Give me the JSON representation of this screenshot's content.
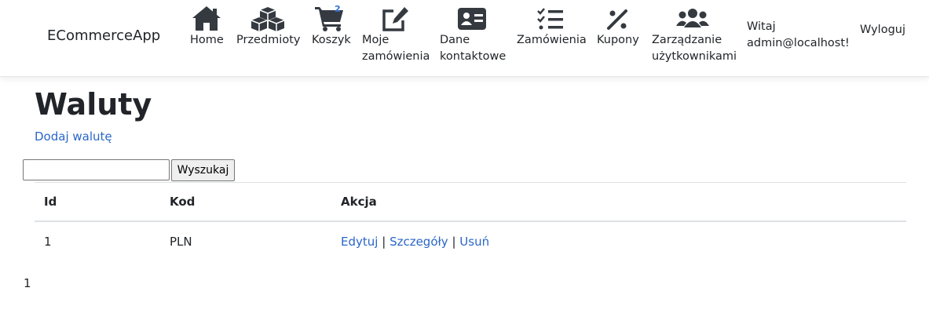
{
  "navbar": {
    "brand": "ECommerceApp",
    "items": [
      {
        "id": "home",
        "label_lines": [
          "Home"
        ],
        "icon": "home-icon"
      },
      {
        "id": "items",
        "label_lines": [
          "Przedmioty"
        ],
        "icon": "cubes-icon"
      },
      {
        "id": "cart",
        "label_lines": [
          "Koszyk"
        ],
        "icon": "cart-icon",
        "badge": "2"
      },
      {
        "id": "my-orders",
        "label_lines": [
          "Moje",
          "zamówienia"
        ],
        "icon": "edit-icon"
      },
      {
        "id": "contact",
        "label_lines": [
          "Dane",
          "kontaktowe"
        ],
        "icon": "contact-card-icon"
      },
      {
        "id": "orders",
        "label_lines": [
          "Zamówienia"
        ],
        "icon": "checklist-icon"
      },
      {
        "id": "coupons",
        "label_lines": [
          "Kupony"
        ],
        "icon": "percent-icon"
      },
      {
        "id": "users",
        "label_lines": [
          "Zarządzanie",
          "użytkownikami"
        ],
        "icon": "users-icon"
      }
    ],
    "greeting_lines": [
      "Witaj",
      "admin@localhost!"
    ],
    "logout": "Wyloguj"
  },
  "page": {
    "title": "Waluty",
    "add_link": "Dodaj walutę"
  },
  "search": {
    "value": "",
    "placeholder": "",
    "button_label": "Wyszukaj"
  },
  "table": {
    "headers": [
      "Id",
      "Kod",
      "Akcja"
    ],
    "rows": [
      {
        "id": "1",
        "kod": "PLN",
        "actions": [
          "Edytuj",
          "Szczegóły",
          "Usuń"
        ]
      }
    ],
    "action_separator": "|"
  },
  "pagination": {
    "current_page": "1"
  },
  "colors": {
    "link": "#2a66c8",
    "text": "#212529",
    "icon": "#343a40",
    "badge": "#2f6fd6"
  }
}
